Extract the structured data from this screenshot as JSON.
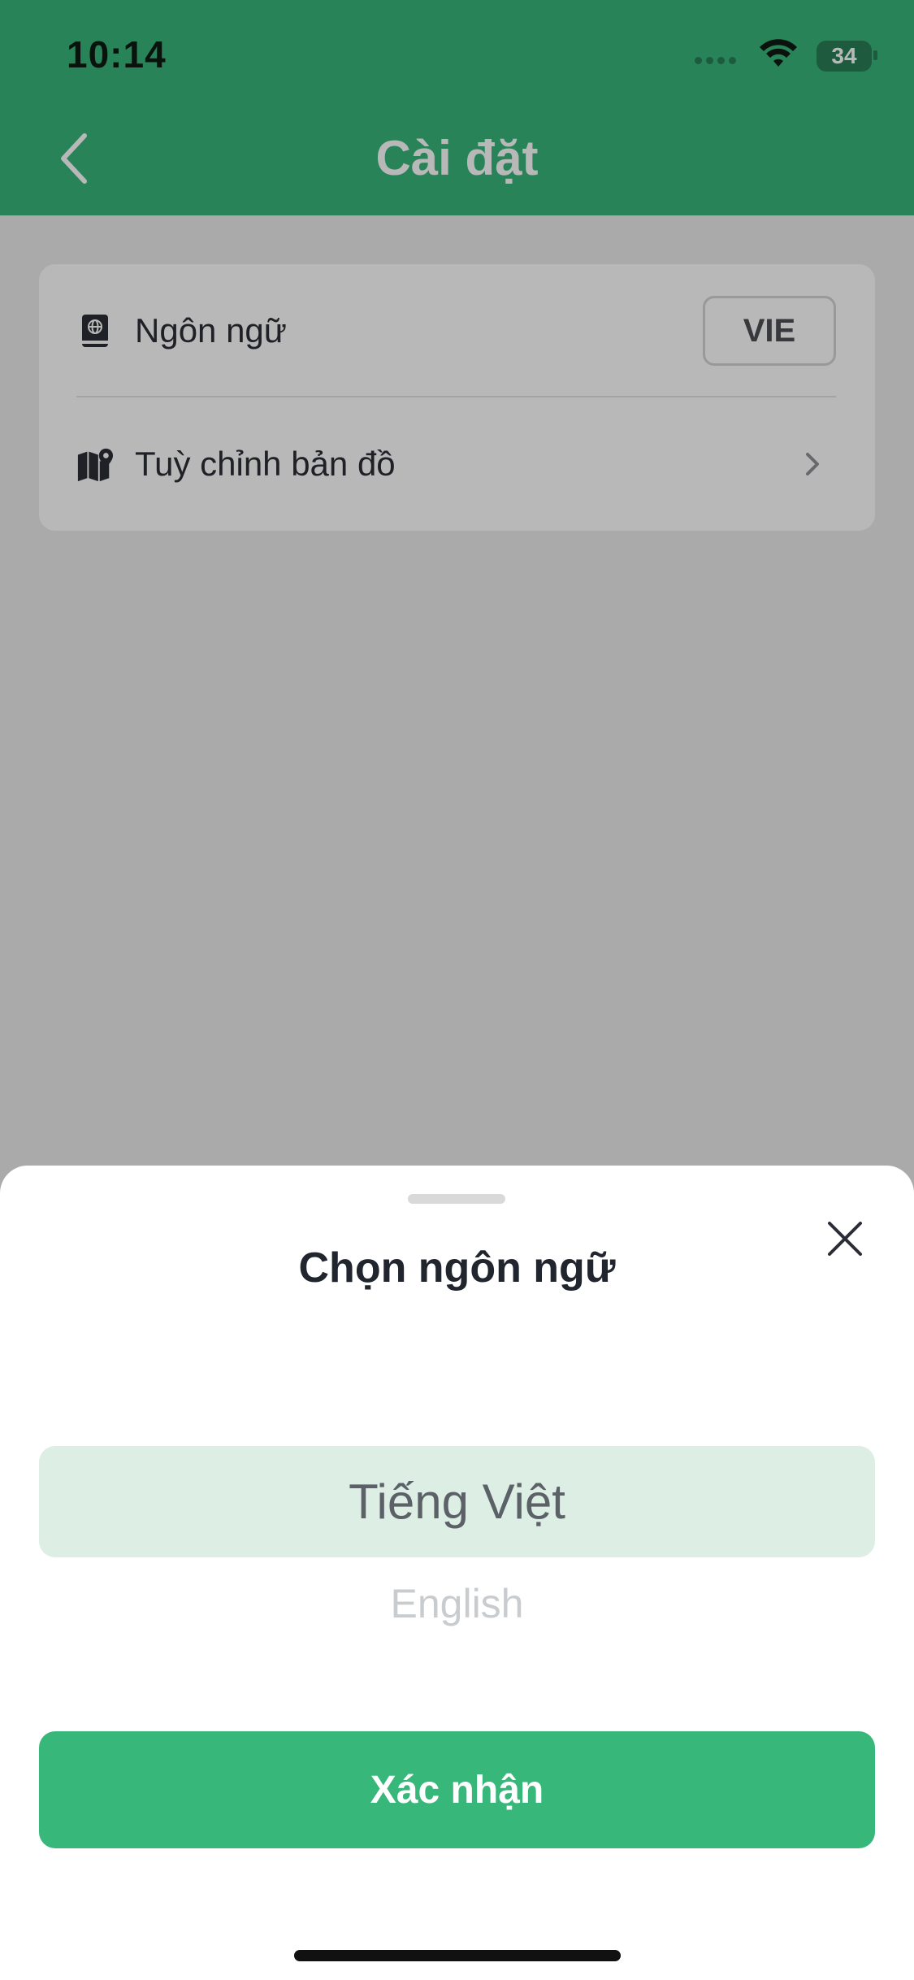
{
  "status_bar": {
    "time": "10:14",
    "battery": "34"
  },
  "header": {
    "title": "Cài đặt",
    "back_icon": "chevron-left-icon"
  },
  "settings": {
    "items": [
      {
        "icon": "language-book-icon",
        "label": "Ngôn ngữ",
        "value": "VIE"
      },
      {
        "icon": "map-pin-icon",
        "label": "Tuỳ chỉnh bản đồ",
        "trailing_icon": "chevron-right-icon"
      }
    ]
  },
  "language_sheet": {
    "title": "Chọn ngôn ngữ",
    "close_icon": "close-icon",
    "options": [
      "Tiếng Việt",
      "English"
    ],
    "selected": "Tiếng Việt",
    "confirm_label": "Xác nhận"
  },
  "colors": {
    "primary": "#38b77a",
    "picker_highlight": "#ddeee4"
  }
}
